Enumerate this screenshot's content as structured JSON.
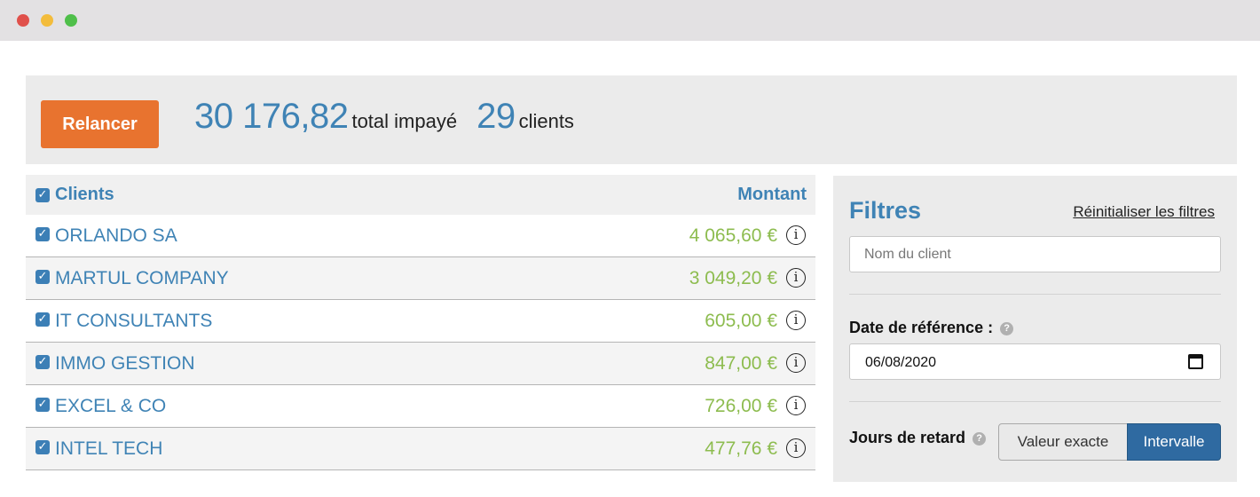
{
  "summary": {
    "button_label": "Relancer",
    "total_amount": "30 176,82",
    "total_label": "total impayé",
    "client_count": "29",
    "client_label": "clients"
  },
  "table": {
    "header_clients": "Clients",
    "header_amount": "Montant",
    "rows": [
      {
        "name": "ORLANDO SA",
        "amount": "4 065,60 €"
      },
      {
        "name": "MARTUL COMPANY",
        "amount": "3 049,20 €"
      },
      {
        "name": "IT CONSULTANTS",
        "amount": "605,00 €"
      },
      {
        "name": "IMMO GESTION",
        "amount": "847,00 €"
      },
      {
        "name": "EXCEL & CO",
        "amount": "726,00 €"
      },
      {
        "name": "INTEL TECH",
        "amount": "477,76 €"
      }
    ]
  },
  "filters": {
    "title": "Filtres",
    "reset_label": "Réinitialiser les filtres",
    "client_placeholder": "Nom du client",
    "date_label": "Date de référence :",
    "date_value": "06/08/2020",
    "delay_label": "Jours de retard",
    "option_exact": "Valeur exacte",
    "option_interval": "Intervalle",
    "selected_option": "Intervalle"
  },
  "colors": {
    "accent_blue": "#3f83b5",
    "button_orange": "#e8732f",
    "amount_green": "#8dbc4f",
    "active_segment": "#2f6aa1"
  },
  "icons": {
    "checkbox": "checkbox-checked-icon",
    "info": "info-icon",
    "help": "question-icon",
    "calendar": "calendar-icon"
  }
}
